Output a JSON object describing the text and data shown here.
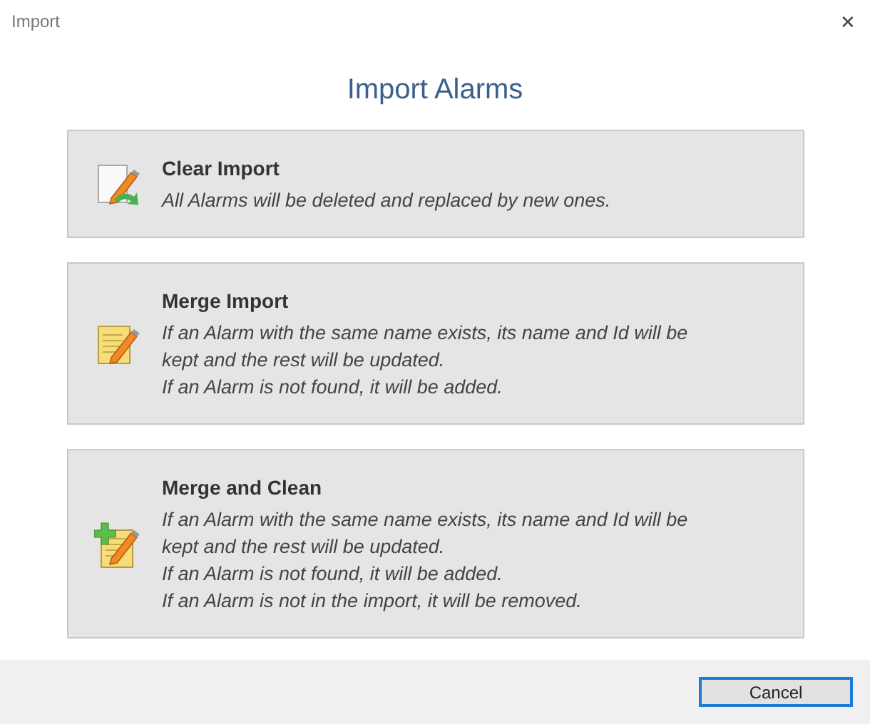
{
  "window": {
    "title": "Import",
    "close": "✕"
  },
  "heading": "Import Alarms",
  "options": [
    {
      "kind": "clear",
      "title": "Clear Import",
      "lines": [
        "All Alarms will be deleted and replaced by new ones."
      ]
    },
    {
      "kind": "merge",
      "title": "Merge Import",
      "lines": [
        "If an Alarm with the same name exists, its name and Id will be",
        "kept and the rest will be updated.",
        "If an Alarm is not found, it will be added."
      ]
    },
    {
      "kind": "clean",
      "title": "Merge and Clean",
      "lines": [
        "If an Alarm with the same name exists, its name and Id will be",
        "kept and the rest will be updated.",
        "If an Alarm is not found, it will be added.",
        "If an Alarm is not in the import, it will be removed."
      ]
    }
  ],
  "buttons": [
    "Cancel"
  ]
}
